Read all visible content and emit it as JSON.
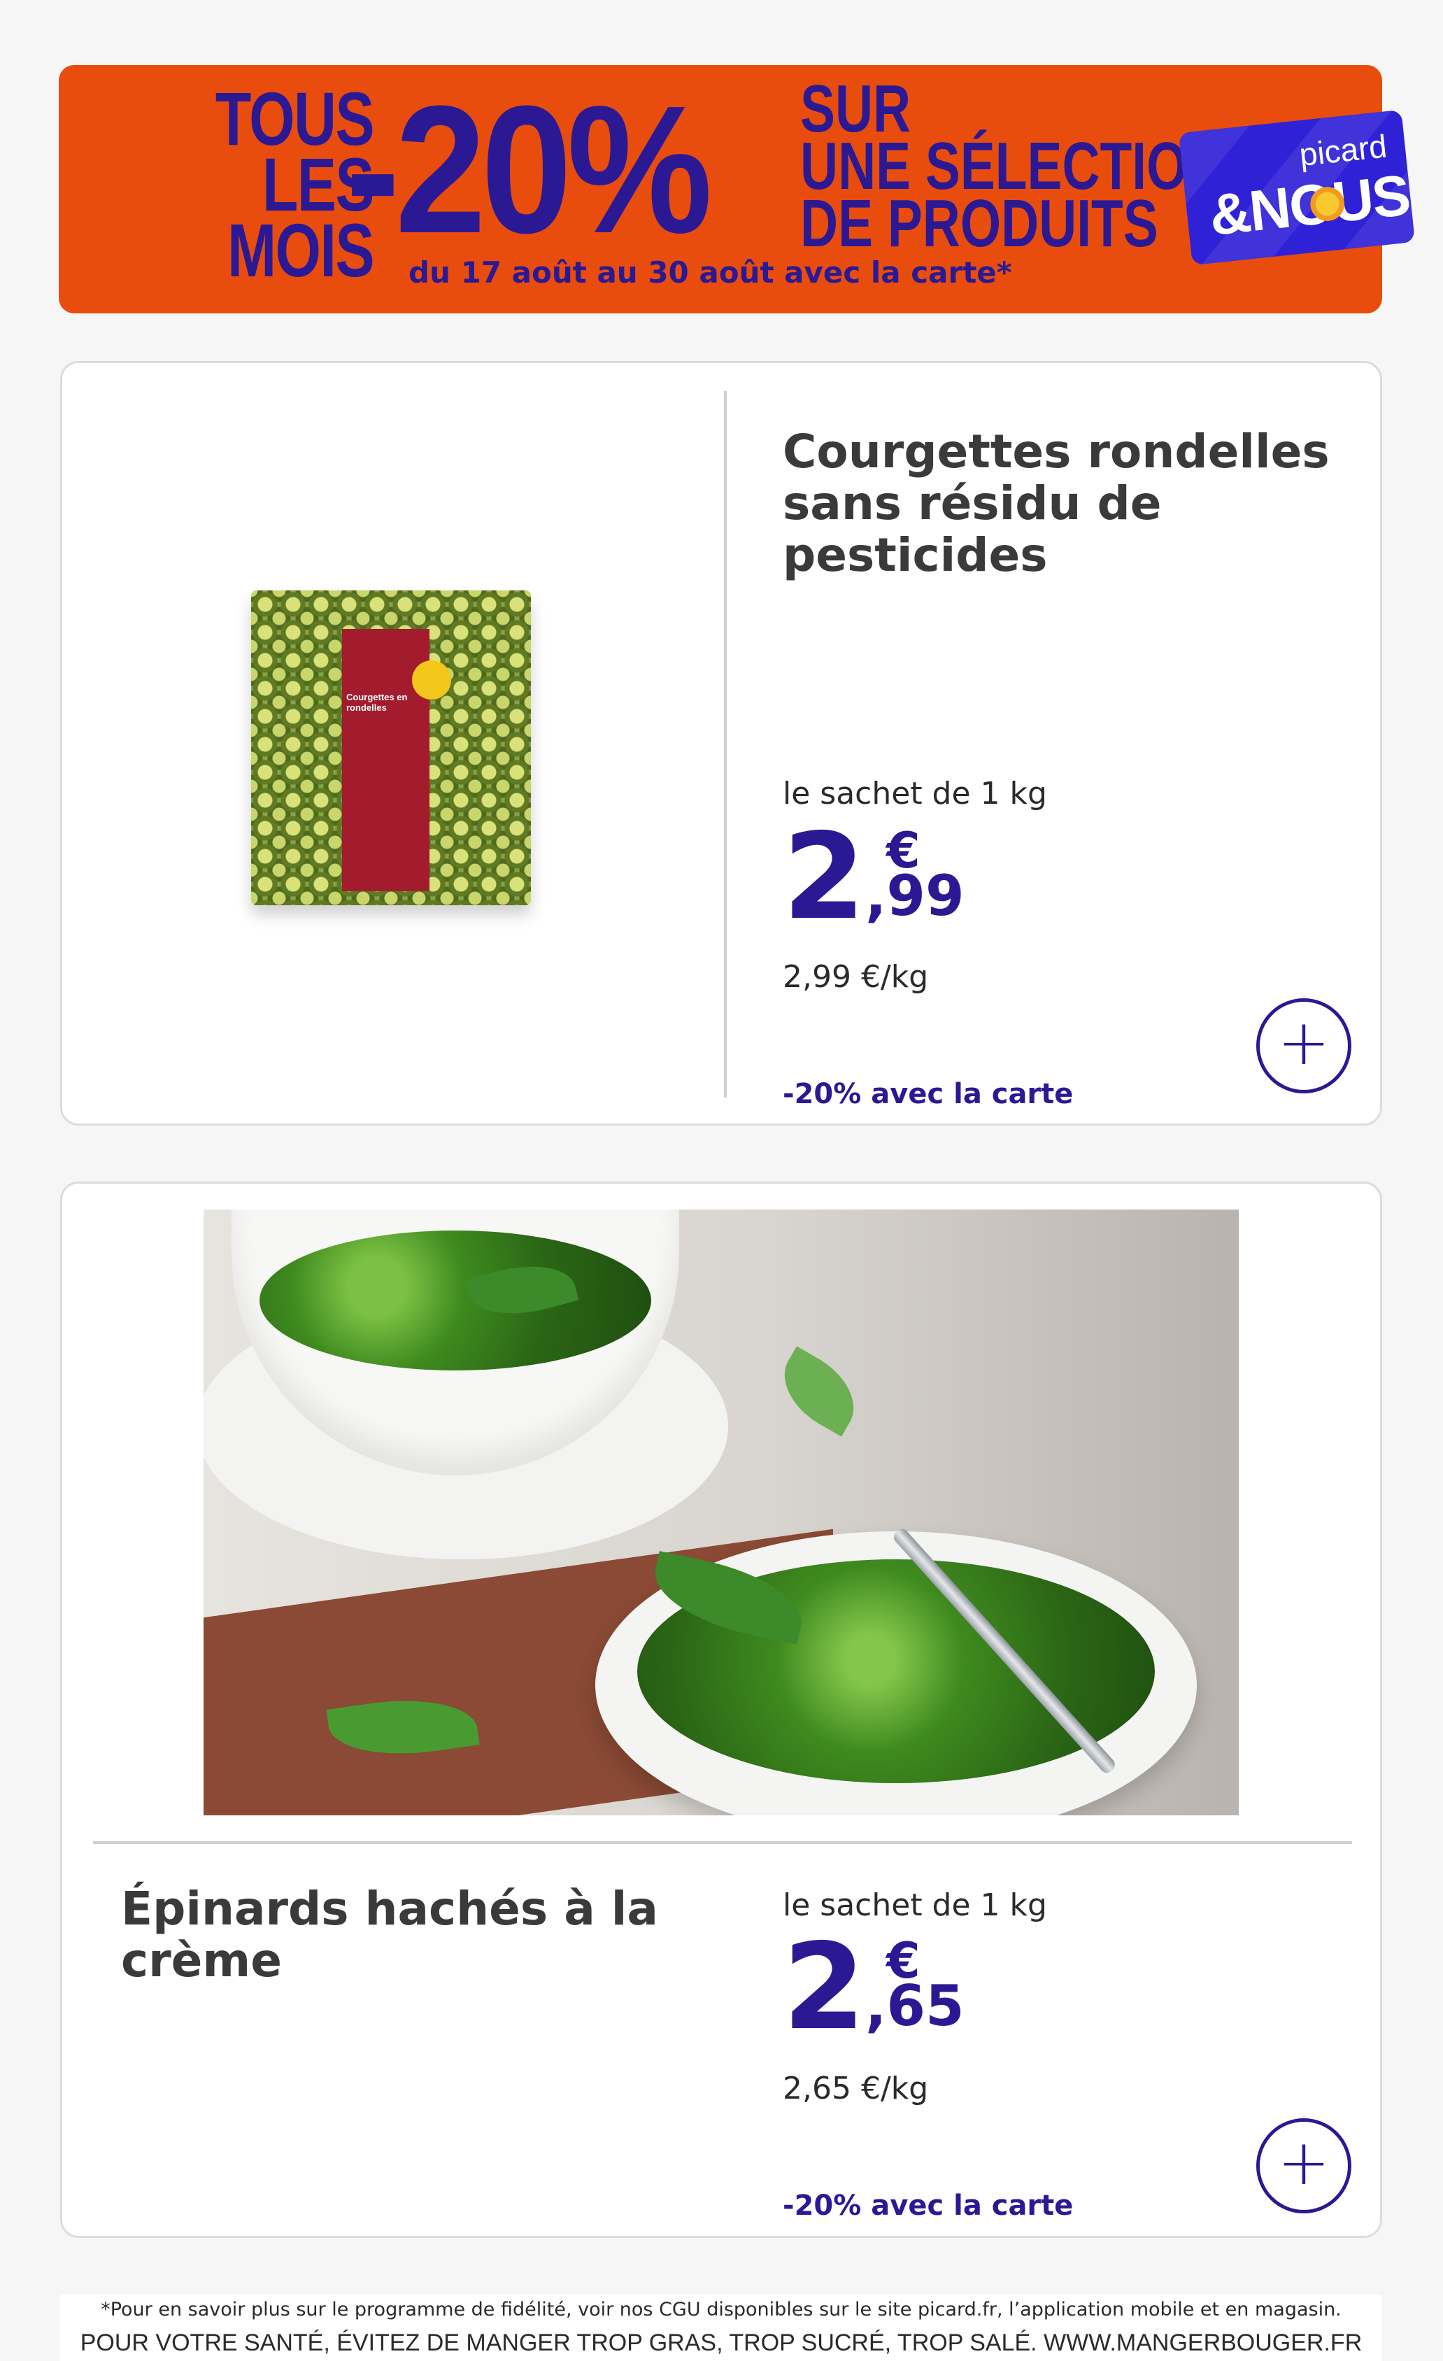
{
  "banner": {
    "left_line1": "TOUS",
    "left_line2": "LES",
    "left_line3": "MOIS",
    "discount": "-20%",
    "right_line1": "SUR",
    "right_line2": "UNE SÉLECTION",
    "right_line3": "DE PRODUITS",
    "dates": "du 17 août au 30 août avec la carte*",
    "card_brand": "picard",
    "card_program": "&NOUS",
    "colors": {
      "background": "#e94d0e",
      "text": "#2b1994",
      "card": "#2f22d6"
    }
  },
  "products": [
    {
      "title": "Courgettes rondelles sans résidu de pesticides",
      "quantity": "le sachet de 1 kg",
      "price_int": "2",
      "price_currency": "€",
      "price_dec": ",99",
      "unit_price": "2,99 €/kg",
      "promo": "-20% avec la carte",
      "add_icon": "plus-icon",
      "pack_text": "Courgettes en rondelles"
    },
    {
      "title": "Épinards hachés à la crème",
      "quantity": "le sachet de 1 kg",
      "price_int": "2",
      "price_currency": "€",
      "price_dec": ",65",
      "unit_price": "2,65 €/kg",
      "promo": "-20% avec la carte",
      "add_icon": "plus-icon"
    }
  ],
  "footer": {
    "note": "*Pour en savoir plus sur le programme de fidélité, voir nos CGU disponibles sur le site picard.fr, l’application mobile et en magasin.",
    "health": "POUR VOTRE SANTÉ, ÉVITEZ DE MANGER TROP GRAS, TROP SUCRÉ, TROP SALÉ. WWW.MANGERBOUGER.FR"
  },
  "accent_color": "#2b1994"
}
